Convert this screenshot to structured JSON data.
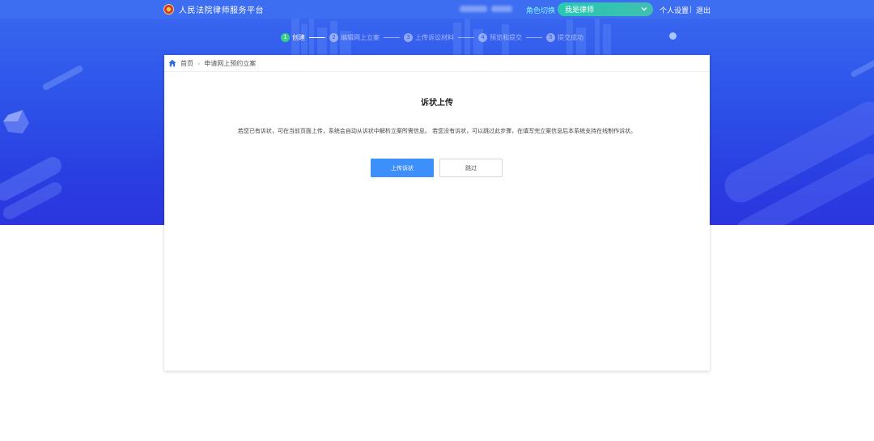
{
  "header": {
    "platform_title": "人民法院律师服务平台",
    "role_switch_label": "角色切换",
    "role_selected": "我是律师",
    "personal_settings": "个人设置",
    "logout": "退出"
  },
  "stepper": {
    "steps": [
      {
        "num": "1",
        "label": "创建"
      },
      {
        "num": "2",
        "label": "编辑网上立案"
      },
      {
        "num": "3",
        "label": "上传诉讼材料"
      },
      {
        "num": "4",
        "label": "预览和提交"
      },
      {
        "num": "5",
        "label": "提交成功"
      }
    ],
    "active_step": 1
  },
  "breadcrumb": {
    "home": "首页",
    "current": "申请网上预约立案"
  },
  "main": {
    "title": "诉状上传",
    "description": "若您已有诉状，可在当前页面上传，系统会自动从诉状中解析立案所需信息。 若您没有诉状，可以跳过此步骤，在填写完立案信息后本系统支持在线制作诉状。",
    "upload_button": "上传诉状",
    "skip_button": "跳过"
  },
  "colors": {
    "hero_blue": "#2e55ea",
    "topbar_blue": "#3d6ef2",
    "role_select_teal": "#27c9b2",
    "primary_button": "#3d8ffb",
    "active_step_green": "#35d08e"
  }
}
